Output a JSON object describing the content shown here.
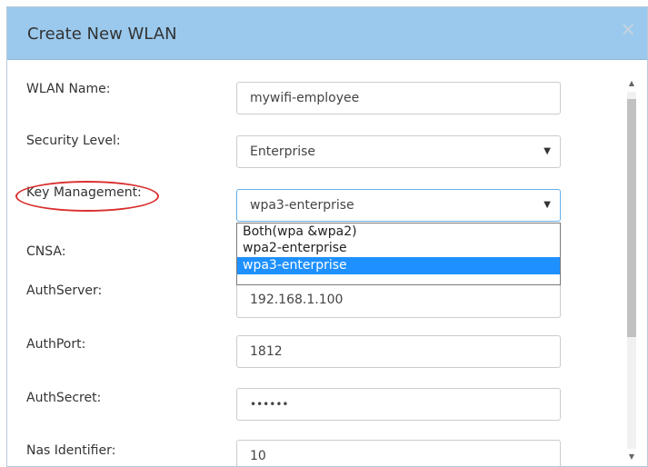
{
  "dialog": {
    "title": "Create New WLAN",
    "close_icon": "close-icon"
  },
  "form": {
    "wlan_name": {
      "label": "WLAN Name:",
      "value": "mywifi-employee"
    },
    "security_level": {
      "label": "Security Level:",
      "value": "Enterprise"
    },
    "key_management": {
      "label": "Key Management:",
      "value": "wpa3-enterprise",
      "options": [
        "Both(wpa &wpa2)",
        "wpa2-enterprise",
        "wpa3-enterprise"
      ],
      "selected_index": 2
    },
    "cnsa": {
      "label": "CNSA:"
    },
    "auth_server": {
      "label": "AuthServer:",
      "value": "192.168.1.100"
    },
    "auth_port": {
      "label": "AuthPort:",
      "value": "1812"
    },
    "auth_secret": {
      "label": "AuthSecret:",
      "value": "••••••"
    },
    "nas_identifier": {
      "label": "Nas Identifier:",
      "value": "10"
    }
  },
  "colors": {
    "header_bg": "#9ac9ed",
    "selected_option_bg": "#1e90ff",
    "annotation_ring": "#d93030"
  }
}
